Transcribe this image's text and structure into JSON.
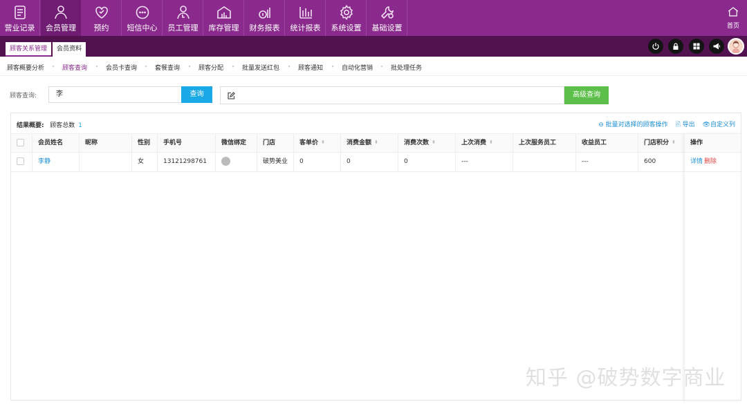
{
  "nav": [
    {
      "label": "营业记录",
      "icon": "document-icon"
    },
    {
      "label": "会员管理",
      "icon": "user-icon"
    },
    {
      "label": "预约",
      "icon": "heart-icon"
    },
    {
      "label": "短信中心",
      "icon": "chat-icon"
    },
    {
      "label": "员工管理",
      "icon": "staff-icon"
    },
    {
      "label": "库存管理",
      "icon": "warehouse-icon"
    },
    {
      "label": "财务报表",
      "icon": "finance-icon"
    },
    {
      "label": "统计报表",
      "icon": "bar-chart-icon"
    },
    {
      "label": "系统设置",
      "icon": "gear-icon"
    },
    {
      "label": "基础设置",
      "icon": "wrench-icon"
    }
  ],
  "home_label": "首页",
  "tabs": [
    "顾客关系管理",
    "会员资料"
  ],
  "submenu": [
    "顾客概要分析",
    "顾客查询",
    "会员卡查询",
    "套餐查询",
    "顾客分配",
    "批量发送红包",
    "顾客通知",
    "自动化营销",
    "批处理任务"
  ],
  "search": {
    "label": "顾客查询:",
    "value": "李",
    "query_button": "查询",
    "advanced_button": "高级查询"
  },
  "summary": {
    "label": "结果概要:",
    "total_label": "顾客总数",
    "total": "1"
  },
  "actions": {
    "batch": "批量对选择的顾客操作",
    "export": "导出",
    "custom_columns": "自定义列"
  },
  "columns": [
    "会员姓名",
    "昵称",
    "性别",
    "手机号",
    "微信绑定",
    "门店",
    "客单价",
    "消费金额",
    "消费次数",
    "上次消费",
    "上次服务员工",
    "收益员工",
    "门店积分",
    "操作"
  ],
  "rows": [
    {
      "name": "李静",
      "nickname": "",
      "gender": "女",
      "phone": "13121298761",
      "store": "破势美业",
      "avg_price": "0",
      "spend": "0",
      "visits": "0",
      "last_visit": "---",
      "last_staff": "",
      "earning_staff": "---",
      "points": "600",
      "op_detail": "详情",
      "op_delete": "删除"
    }
  ],
  "watermark": "知乎 @破势数字商业",
  "colors": {
    "nav_bg": "#8a2a8c",
    "nav_active": "#6f1c72",
    "subbar_bg": "#52124f",
    "query_btn": "#1aa8e6",
    "adv_btn": "#5cbf49"
  }
}
